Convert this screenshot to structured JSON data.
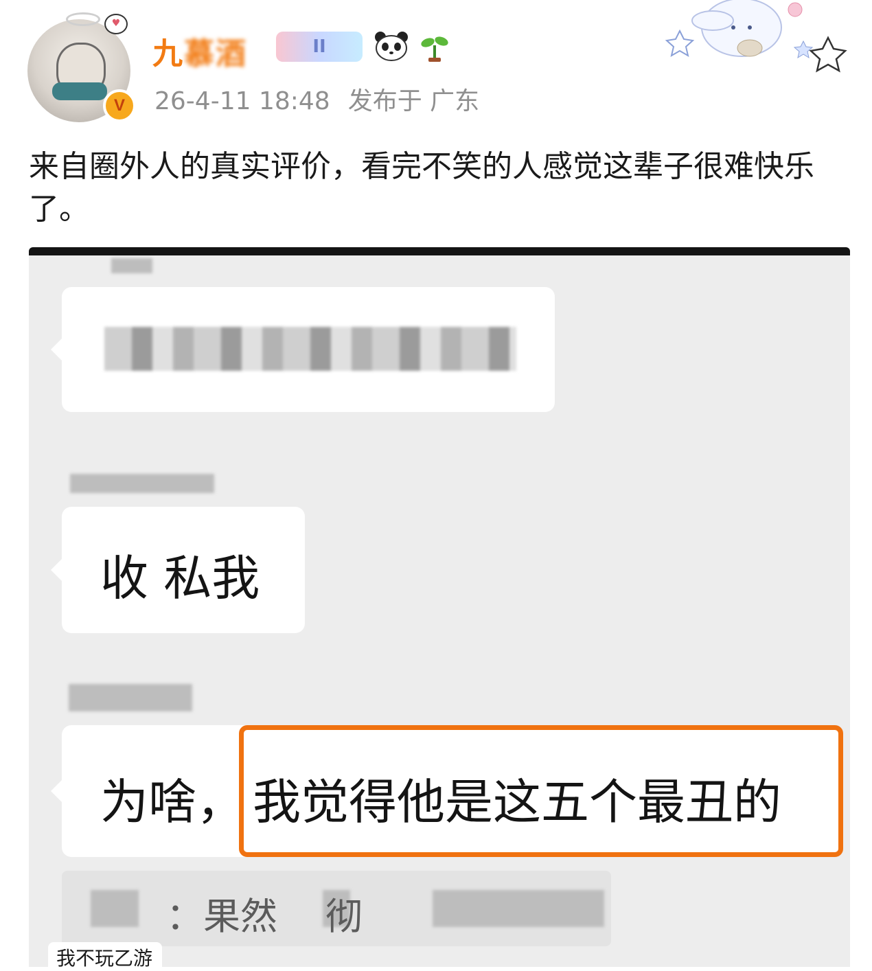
{
  "post": {
    "username": "九慕酒",
    "username_visible": "九",
    "username_obscured": "慕酒",
    "badge": "II",
    "timestamp": "26-4-11 18:48",
    "location": "发布于 广东",
    "text": "来自圈外人的真实评价，看完不笑的人感觉这辈子很难快乐了。"
  },
  "screenshot": {
    "messages": [
      {
        "text": "收 私我"
      },
      {
        "text": "为啥，"
      },
      {
        "text": "我觉得他是这五个最丑的"
      }
    ],
    "quote": "：果然",
    "quote_tail": "彻",
    "watermark": "我不玩乙游"
  },
  "colors": {
    "username": "#f27b13",
    "highlight": "#f07210",
    "verified_badge": "#f7a81d"
  },
  "icons": [
    "avatar",
    "verified-icon",
    "badge-icon",
    "panda-icon",
    "sprout-icon",
    "star-decoration"
  ]
}
